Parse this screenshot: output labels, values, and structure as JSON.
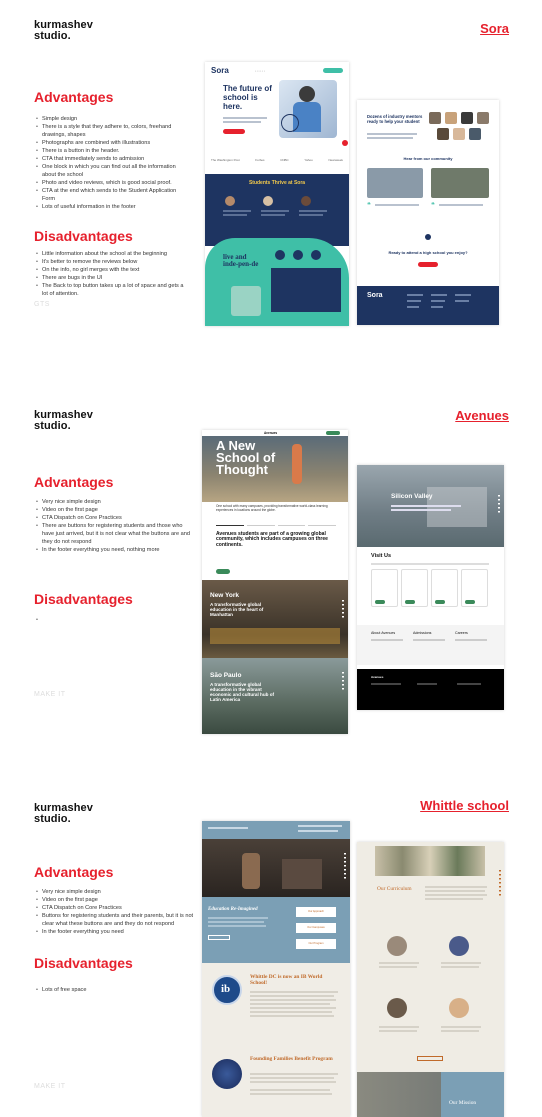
{
  "brand": {
    "line1": "kurmashev",
    "line2": "studio."
  },
  "ghost_text": {
    "sora": "GTS",
    "avenues": "MAKE IT",
    "whittle": "MAKE IT"
  },
  "colors": {
    "accent_red": "#e6212d",
    "sora_navy": "#1e3461",
    "sora_teal": "#3fbfa7",
    "whittle_blue": "#7b9fb5"
  },
  "sora": {
    "title": "Sora",
    "advantages_heading": "Advantages",
    "advantages": [
      "Simple design",
      "There is a style that they adhere to, colors, freehand drawings, shapes",
      "Photographs are combined with illustrations",
      "There is a button in the header.",
      "CTA that immediately sends to admission",
      "One block in which you can find out all the information about the school",
      "Photo and video reviews, which is good social proof.",
      "CTA at the end which sends to the Student Application Form",
      "Lots of useful information in the footer"
    ],
    "disadvantages_heading": "Disadvantages",
    "disadvantages": [
      "Little information about the school at the beginning",
      "It's better to remove the reviews below",
      "On the info, no girl merges with the text",
      "There are bugs in the UI",
      "The Back to top button takes up a lot of space and gets a lot of attention."
    ],
    "screenshot": {
      "logo": "Sora",
      "hero_title": "The future of school is here.",
      "section_thrive": "Students Thrive at Sora",
      "live_text": "live and inde-pen-de",
      "mentors_title": "Dozens of industry mentors ready to help your student",
      "community_title": "Hear from our community",
      "cta_title": "Ready to attend a high school you enjoy?",
      "footer_logo": "Sora",
      "press_logos": [
        "The Washington Post",
        "Forbes",
        "CNBC",
        "Yahoo",
        "Newsweek"
      ]
    }
  },
  "avenues": {
    "title": "Avenues",
    "advantages_heading": "Advantages",
    "advantages": [
      "Very nice simple design",
      "Video on the first page",
      "CTA Dispatch on Core Practices",
      "There are buttons for registering students and those who have just arrived, but it is not clear what the buttons are and they do not respond",
      "In the footer everything you need, nothing more"
    ],
    "disadvantages_heading": "Disadvantages",
    "disadvantages": [
      ""
    ],
    "screenshot": {
      "logo": "Avenues",
      "hero_title": "A New School of Thought",
      "intro": "One school with many campuses, providing transformative world-class learning experiences in locations around the globe.",
      "campuses_heading": "Avenues students are part of a growing global community, which includes campuses on three continents.",
      "new_york_title": "New York",
      "new_york_sub": "A transformative global education in the heart of Manhattan",
      "sao_paulo_title": "São Paulo",
      "sao_paulo_sub": "A transformative global education in the vibrant economic and cultural hub of Latin America",
      "silicon_valley_title": "Silicon Valley",
      "visit_us": "Visit Us",
      "footer_cols": [
        "About Avenues",
        "Admissions",
        "Careers"
      ]
    }
  },
  "whittle": {
    "title": "Whittle school",
    "advantages_heading": "Advantages",
    "advantages": [
      "Very nice simple design",
      "Video on the first page",
      "CTA Dispatch on Core Practices",
      "Buttons for registering students and their parents, but it is not clear what these buttons are and they do not respond",
      "In the footer everything you need"
    ],
    "disadvantages_heading": "Disadvantages",
    "disadvantages": [
      "Lots of free space"
    ],
    "screenshot": {
      "education_title": "Education Re-Imagined",
      "ib_title": "Whittle DC is now an IB World School!",
      "founding_title": "Founding Families Benefit Program",
      "curriculum_title": "Our Curriculum",
      "mission_title": "Our Mission",
      "side_buttons": [
        "Our Approach",
        "Our Campuses",
        "Our Program"
      ]
    }
  }
}
